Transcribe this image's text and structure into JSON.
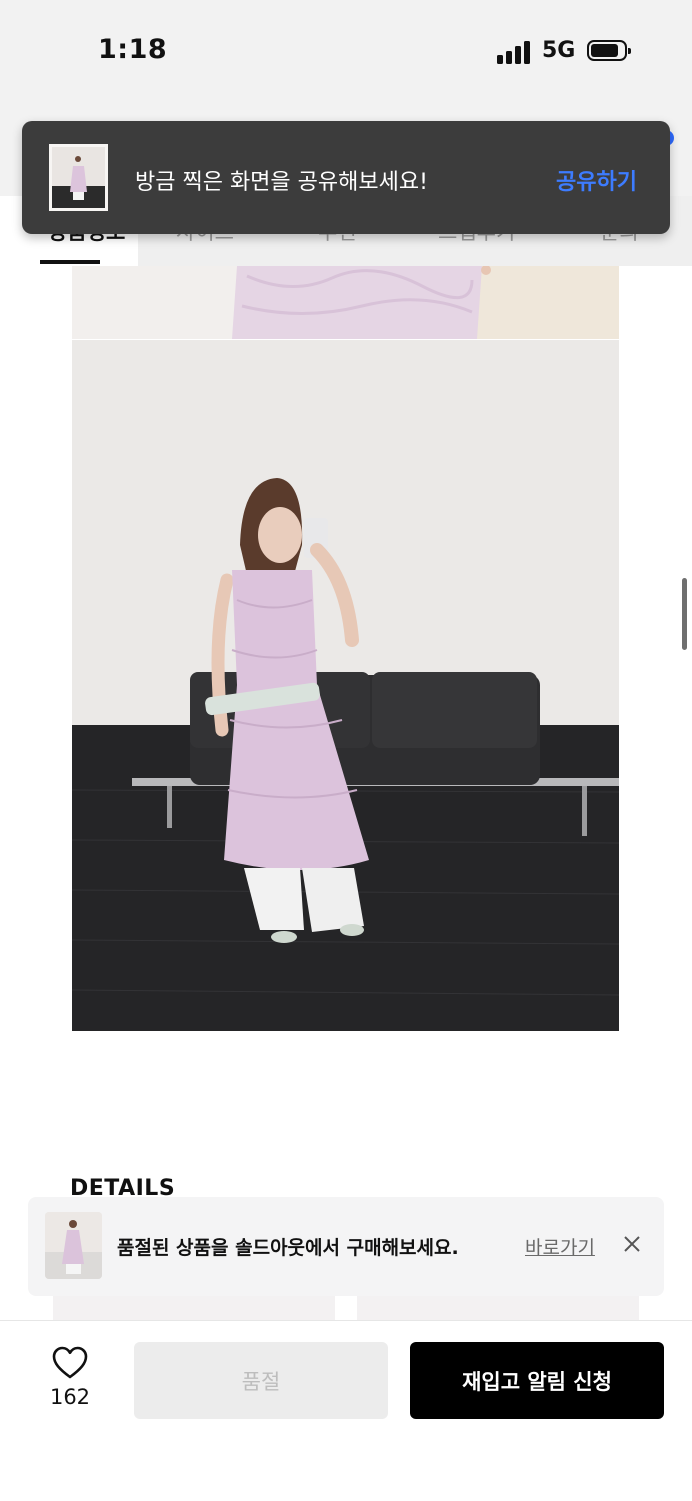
{
  "status_bar": {
    "time": "1:18",
    "network": "5G",
    "battery_level": 0.8
  },
  "tabs": [
    {
      "label": "상품정보",
      "active": true
    },
    {
      "label": "사이즈",
      "active": false
    },
    {
      "label": "추천",
      "active": false
    },
    {
      "label": "스냅후기",
      "active": false
    },
    {
      "label": "문의",
      "active": false
    }
  ],
  "share_toast": {
    "message": "방금 찍은 화면을 공유해보세요!",
    "action": "공유하기"
  },
  "details_heading": "DETAILS",
  "soldout_banner": {
    "message": "품절된 상품을 솔드아웃에서 구매해보세요.",
    "link": "바로가기"
  },
  "bottom_bar": {
    "like_count": "162",
    "soldout_label": "품절",
    "restock_label": "재입고 알림 신청"
  },
  "icons": [
    "heart-icon",
    "close-icon",
    "cellular-signal-icon",
    "battery-icon"
  ],
  "colors": {
    "toast_bg": "#3c3c3c",
    "share_action": "#3d7cff",
    "primary_button": "#000000",
    "disabled_button": "#ececec"
  }
}
